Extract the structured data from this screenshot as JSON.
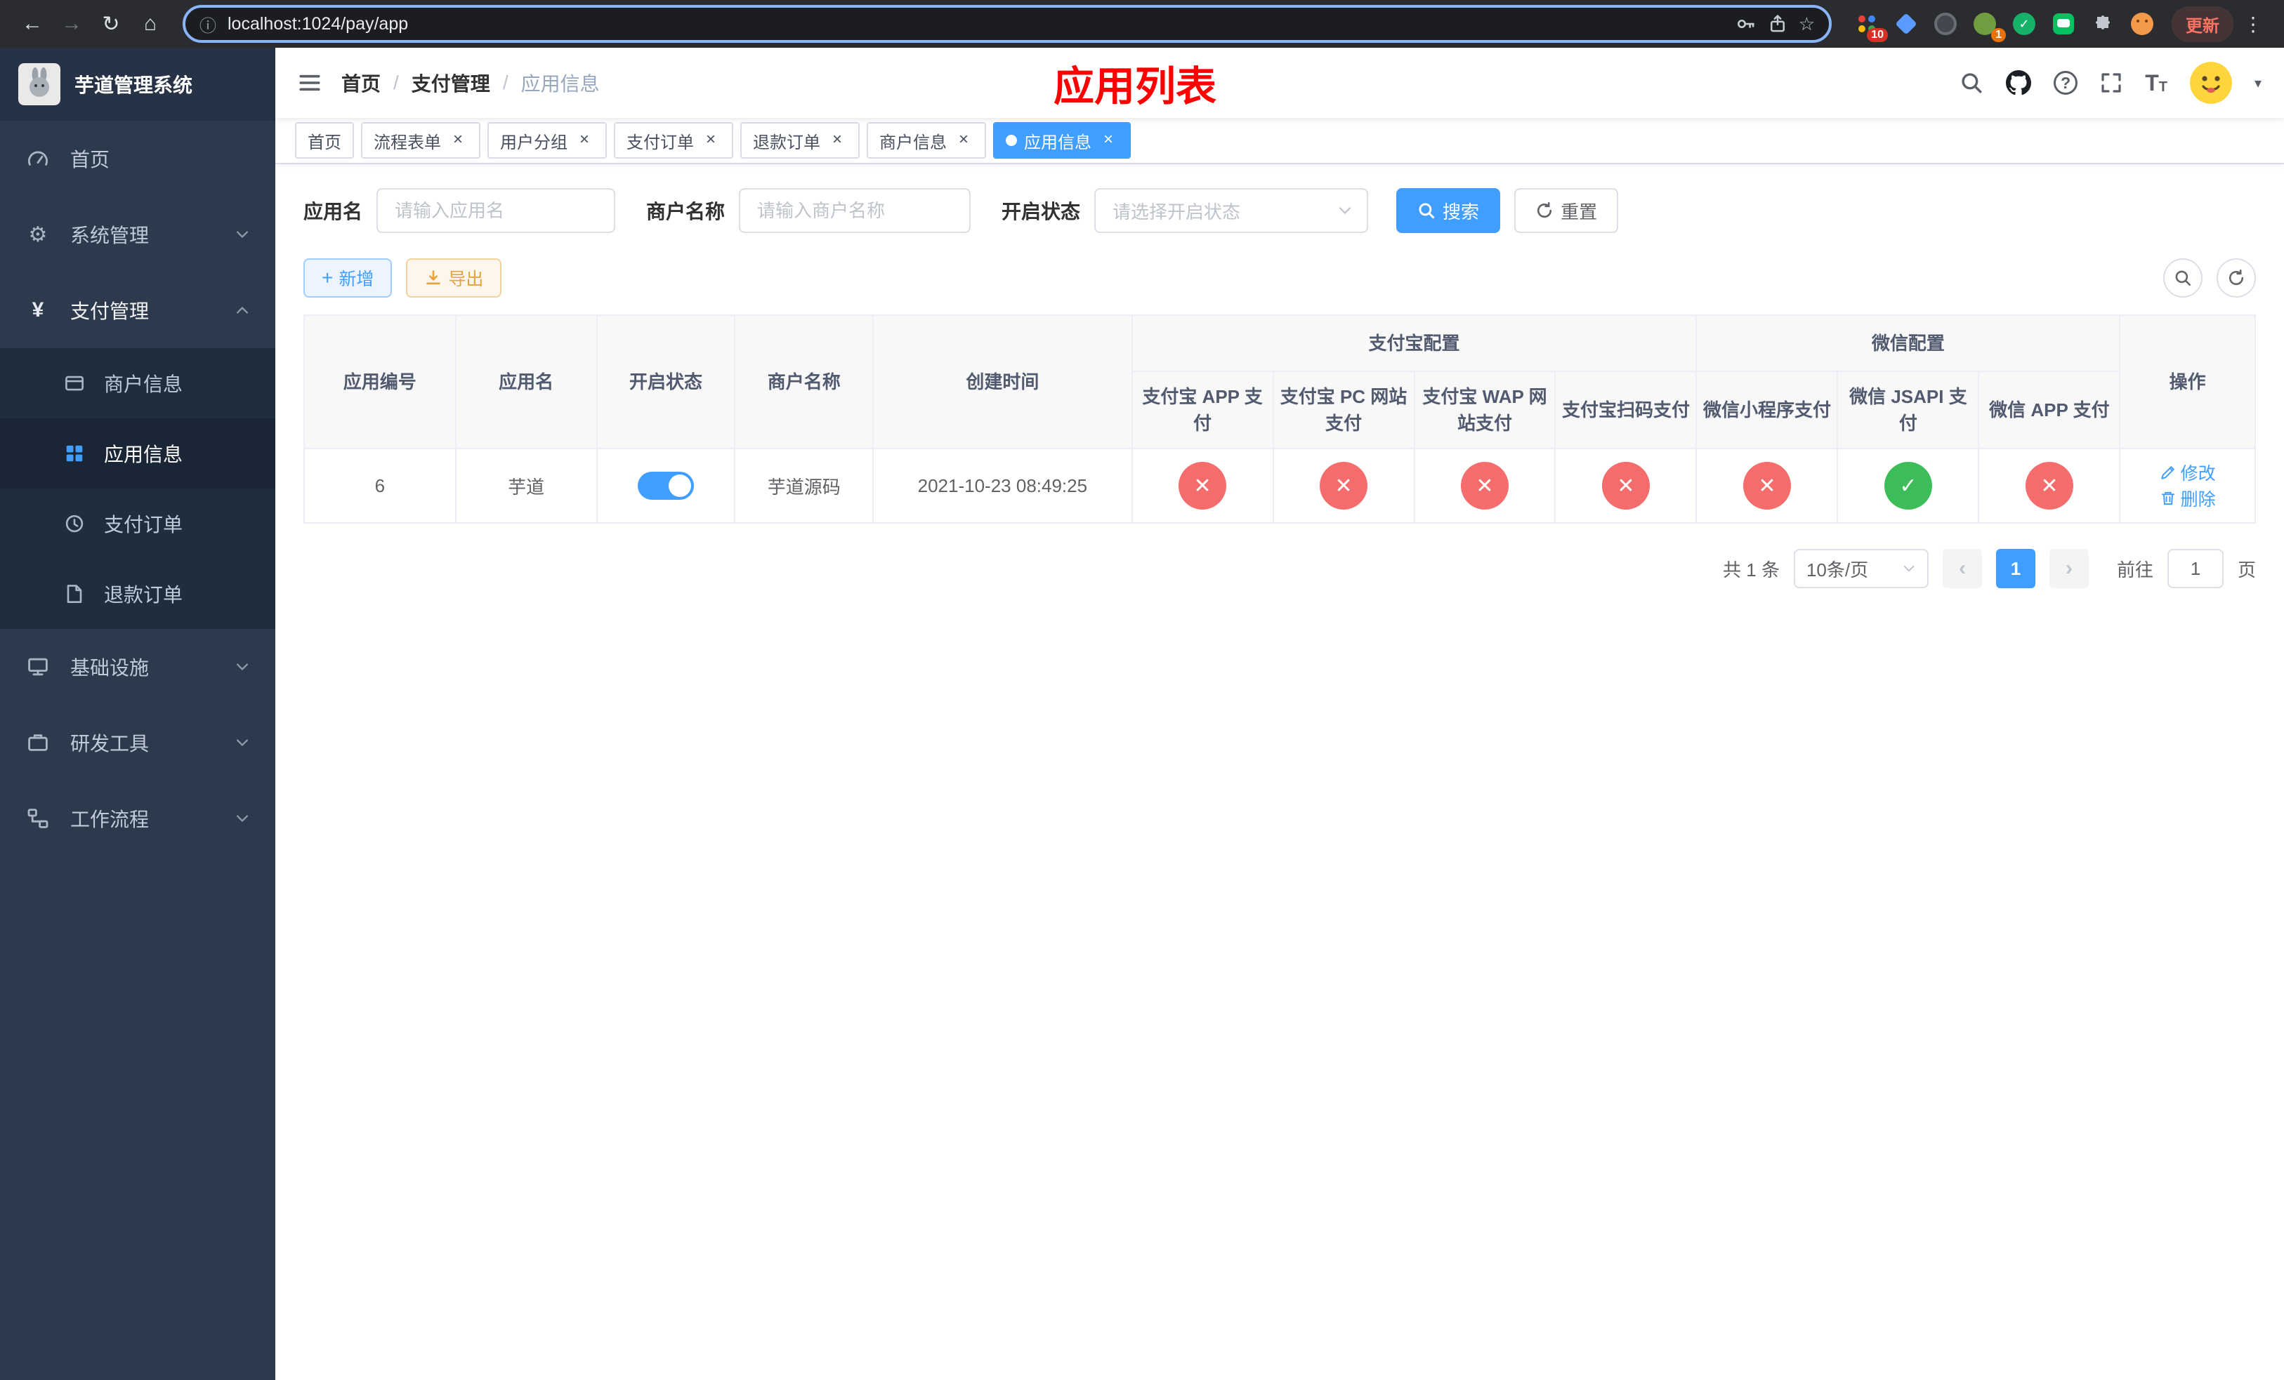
{
  "browser": {
    "url": "localhost:1024/pay/app",
    "update_label": "更新",
    "extensions_badge": "10",
    "profile_badge": "1"
  },
  "icons": {
    "back": "←",
    "forward": "→",
    "reload": "↻",
    "home": "⌂",
    "kebab": "⋮",
    "star": "☆",
    "info": "ⓘ",
    "gear": "⚙",
    "yen": "¥",
    "question": "?",
    "font_large": "T",
    "font_small": "T",
    "plus": "+",
    "check": "✓",
    "cross": "✕",
    "prev": "‹",
    "next": "›",
    "caret": "▾",
    "close": "×"
  },
  "sidebar": {
    "app_title": "芋道管理系统",
    "items": [
      {
        "label": "首页"
      },
      {
        "label": "系统管理"
      },
      {
        "label": "支付管理"
      },
      {
        "label": "基础设施"
      },
      {
        "label": "研发工具"
      },
      {
        "label": "工作流程"
      }
    ],
    "payment_children": [
      {
        "label": "商户信息"
      },
      {
        "label": "应用信息"
      },
      {
        "label": "支付订单"
      },
      {
        "label": "退款订单"
      }
    ]
  },
  "header": {
    "breadcrumb": [
      "首页",
      "支付管理",
      "应用信息"
    ],
    "page_title": "应用列表"
  },
  "tabs": [
    {
      "label": "首页"
    },
    {
      "label": "流程表单"
    },
    {
      "label": "用户分组"
    },
    {
      "label": "支付订单"
    },
    {
      "label": "退款订单"
    },
    {
      "label": "商户信息"
    },
    {
      "label": "应用信息"
    }
  ],
  "filters": {
    "app_name_label": "应用名",
    "app_name_placeholder": "请输入应用名",
    "merchant_label": "商户名称",
    "merchant_placeholder": "请输入商户名称",
    "status_label": "开启状态",
    "status_placeholder": "请选择开启状态",
    "search_label": "搜索",
    "reset_label": "重置"
  },
  "toolbar": {
    "add_label": "新增",
    "export_label": "导出"
  },
  "table": {
    "headers": {
      "app_id": "应用编号",
      "app_name": "应用名",
      "status": "开启状态",
      "merchant": "商户名称",
      "created": "创建时间",
      "alipay_group": "支付宝配置",
      "wechat_group": "微信配置",
      "alipay_app": "支付宝 APP 支付",
      "alipay_pc": "支付宝 PC 网站支付",
      "alipay_wap": "支付宝 WAP 网站支付",
      "alipay_scan": "支付宝扫码支付",
      "wx_mini": "微信小程序支付",
      "wx_jsapi": "微信 JSAPI 支付",
      "wx_app": "微信 APP 支付",
      "actions": "操作"
    },
    "row": {
      "id": "6",
      "name": "芋道",
      "enabled": true,
      "merchant": "芋道源码",
      "created": "2021-10-23 08:49:25",
      "configs": [
        false,
        false,
        false,
        false,
        false,
        true,
        false
      ]
    },
    "actions": {
      "edit": "修改",
      "delete": "删除"
    }
  },
  "pagination": {
    "total": "共 1 条",
    "page_size": "10条/页",
    "page": "1",
    "goto_label": "前往",
    "goto_value": "1",
    "goto_unit": "页"
  },
  "colors": {
    "primary": "#409eff",
    "danger": "#f56c6c",
    "success": "#3dbd5a",
    "title_red": "#ff0000",
    "sidebar_bg": "#2d3a4d",
    "submenu_bg": "#1f2d3d"
  }
}
